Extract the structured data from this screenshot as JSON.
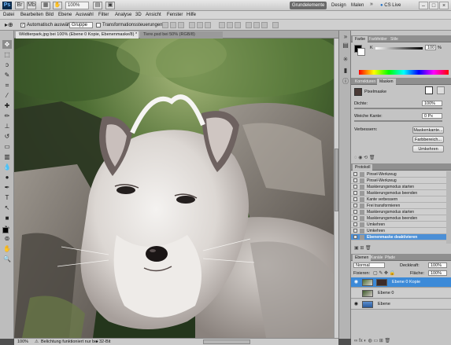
{
  "app": {
    "logo": "Ps",
    "zoom": "100%",
    "workspaces": [
      "Grundelemente",
      "Design",
      "Malen"
    ],
    "active_workspace": "Grundelemente",
    "cs_live": "CS Live",
    "window_controls": [
      "–",
      "□",
      "×"
    ]
  },
  "menu": [
    "Datei",
    "Bearbeiten",
    "Bild",
    "Ebene",
    "Auswahl",
    "Filter",
    "Analyse",
    "3D",
    "Ansicht",
    "Fenster",
    "Hilfe"
  ],
  "options_bar": {
    "auto_select_label": "Automatisch auswählen:",
    "auto_select_value": "Gruppe",
    "transform_label": "Transformationssteuerungen"
  },
  "documents": {
    "active_tab": "Wildtierpark.jpg bei 100% (Ebene 0 Kopie, Ebenenmaske/8) *",
    "inactive_tab": "Tiere.psd bei 50% (RGB/8)"
  },
  "status": {
    "zoom": "100%",
    "message": "Belichtung funktioniert nur bei 32-Bit"
  },
  "color_panel": {
    "tabs": [
      "Farbe",
      "Farbfelder",
      "Stile"
    ],
    "channel": "K",
    "value": "100",
    "unit": "%"
  },
  "masks_panel": {
    "tabs": [
      "Korrekturen",
      "Masken"
    ],
    "title": "Pixelmaske",
    "density_label": "Dichte:",
    "density_value": "100%",
    "feather_label": "Weiche Kante:",
    "feather_value": "0 Px",
    "refine_label": "Verbessern:",
    "buttons": [
      "Maskenkante...",
      "Farbbereich...",
      "Umkehren"
    ]
  },
  "history_panel": {
    "title": "Protokoll",
    "items": [
      "Pinsel-Werkzeug",
      "Pinsel-Werkzeug",
      "Maskierungsmodus starten",
      "Maskierungsmodus beenden",
      "Kante verbessern",
      "Frei transformieren",
      "Maskierungsmodus starten",
      "Maskierungsmodus beenden",
      "Umkehren",
      "Umkehren",
      "Ebenenmaske deaktivieren"
    ],
    "active_index": 10
  },
  "layers_panel": {
    "tabs": [
      "Ebenen",
      "Kanäle",
      "Pfade"
    ],
    "blend_mode": "Normal",
    "opacity_label": "Deckkraft:",
    "opacity_value": "100%",
    "lock_label": "Fixieren:",
    "fill_label": "Fläche:",
    "fill_value": "100%",
    "layers": [
      {
        "name": "Ebene 0 Kopie",
        "active": true
      },
      {
        "name": "Ebene 0",
        "active": false
      },
      {
        "name": "Ebene",
        "active": false
      }
    ]
  }
}
